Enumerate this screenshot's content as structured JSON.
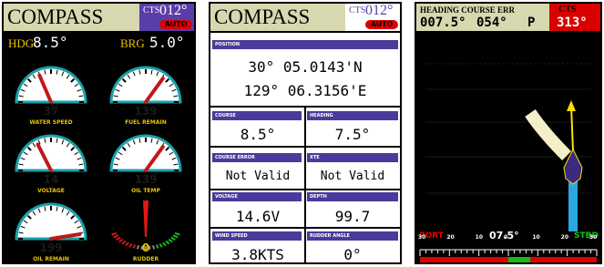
{
  "panel1": {
    "title": "COMPASS",
    "cts_label": "CTS",
    "cts_value": "012°",
    "auto_label": "AUTO",
    "hdg_label": "HDG",
    "hdg_value": "8.5°",
    "brg_label": "BRG",
    "brg_value": "5.0°",
    "gauges": [
      {
        "label": "WATER SPEED",
        "value": "37",
        "level": 0.37
      },
      {
        "label": "FUEL REMAIN",
        "value": "139",
        "level": 0.7
      },
      {
        "label": "VOLTAGE",
        "value": "14",
        "level": 0.35
      },
      {
        "label": "OIL TEMP",
        "value": "139",
        "level": 0.7
      },
      {
        "label": "OIL REMAIN",
        "value": "199",
        "level": 0.95
      },
      {
        "label": "RUDDER",
        "value": "0",
        "level": 0.5
      }
    ]
  },
  "panel2": {
    "title": "COMPASS",
    "cts_label": "CTS",
    "cts_value": "012°",
    "auto_label": "AUTO",
    "position_label": "POSITION",
    "position_lat": "30° 05.0143'N",
    "position_lon": "129° 06.3156'E",
    "course_label": "COURSE",
    "course_value": "8.5°",
    "heading_label": "HEADING",
    "heading_value": "7.5°",
    "course_error_label": "COURSE ERROR",
    "course_error_value": "Not Valid",
    "xte_label": "XTE",
    "xte_value": "Not Valid",
    "voltage_label": "VOLTAGE",
    "voltage_value": "14.6V",
    "depth_label": "DEPTH",
    "depth_value": "99.7",
    "wind_label": "WIND SPEED",
    "wind_value": "3.8KTS",
    "rudder_label": "RUDDER ANGLE",
    "rudder_value": "0°"
  },
  "panel3": {
    "hdr_label": "HEADING COURSE ERR",
    "heading_value": "007.5°",
    "course_value": "054°",
    "err_value": "P",
    "cts_label": "CTS",
    "cts_value": "313°",
    "port_label": "PORT",
    "stbd_label": "STBD",
    "scale_center": "07.5°",
    "scale_ticks": [
      "30",
      "20",
      "10",
      "0",
      "10",
      "20",
      "30"
    ]
  },
  "colors": {
    "accent": "#4a3a9c",
    "warning": "#d80000",
    "gauge_label": "#e8c200"
  }
}
